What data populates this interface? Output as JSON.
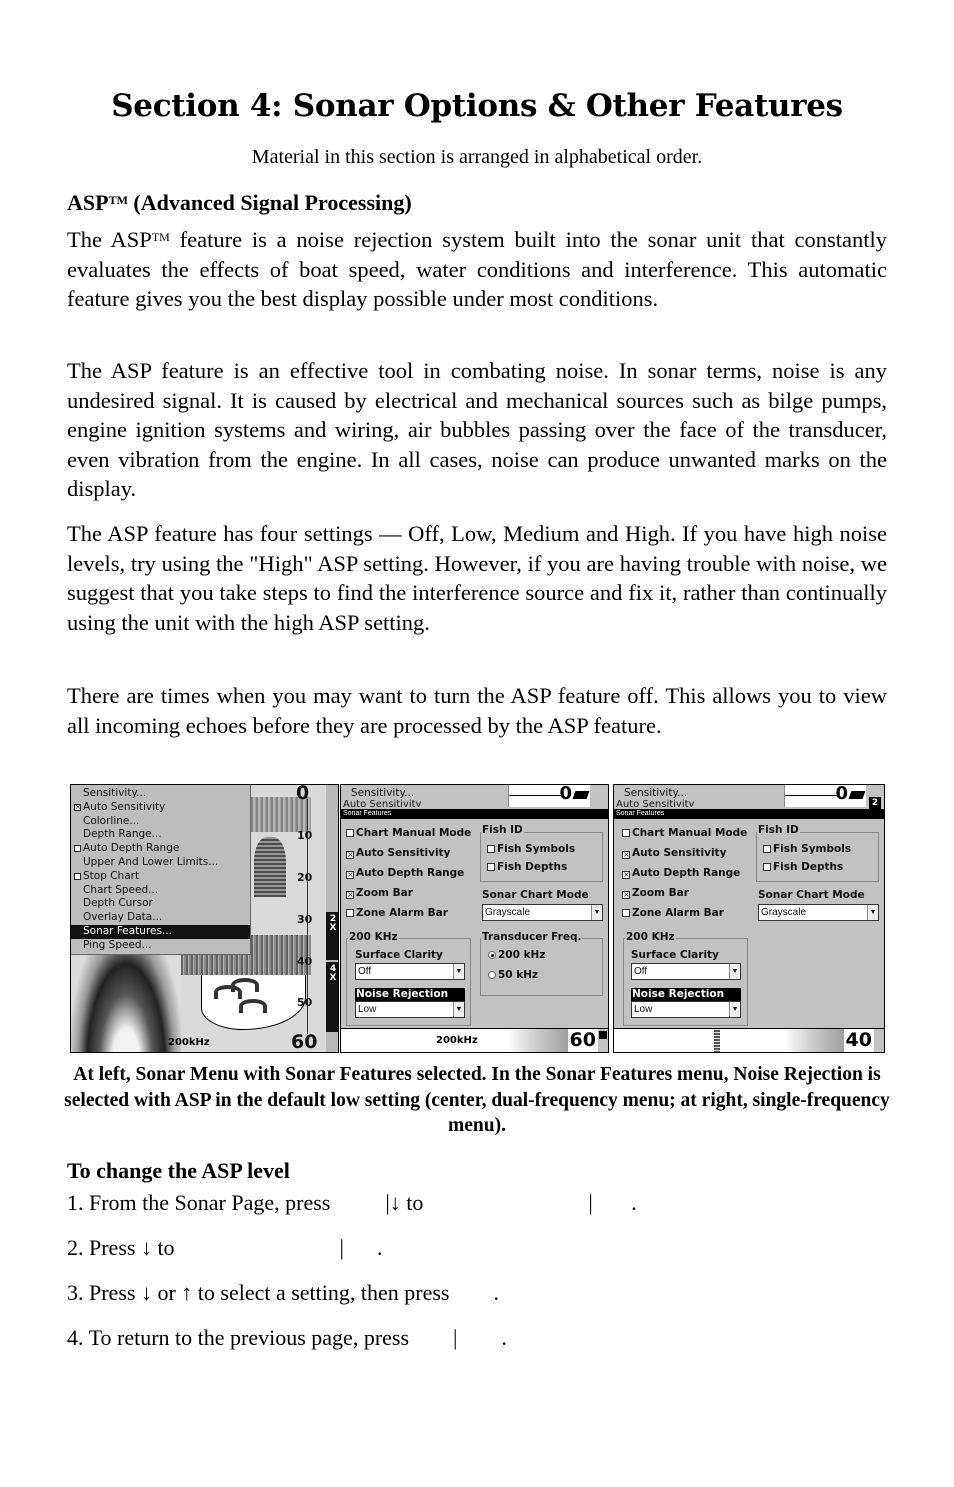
{
  "page": {
    "title": "Section 4: Sonar Options & Other Features",
    "subtitle": "Material in this section is arranged in alphabetical order."
  },
  "asp_section": {
    "heading_prefix": "ASP",
    "heading_tm": "TM",
    "heading_suffix": " (Advanced Signal Processing)",
    "paragraphs": [
      {
        "prefix": "The ASP",
        "tm": "TM",
        "text": " feature is a noise rejection system built into the sonar unit that constantly evaluates the effects of boat speed, water conditions and interference. This automatic feature gives you the best display possible under most conditions."
      },
      {
        "text": "The ASP feature is an effective tool in combating noise. In sonar terms, noise is any undesired signal. It is caused by electrical and mechanical sources such as bilge pumps, engine ignition systems and wiring, air bubbles passing over the face of the transducer, even vibration from the engine. In all cases, noise can produce unwanted marks on the display."
      },
      {
        "text": "The ASP feature has four settings — Off, Low, Medium and High. If you have high noise levels, try using the \"High\" ASP setting. However, if you are having trouble with noise, we suggest that you take steps to find the interference source and fix it, rather than continually using the unit with the high ASP setting."
      },
      {
        "text": "There are times when you may want to turn the ASP feature off. This allows you to view all incoming echoes before they are processed by the ASP feature."
      }
    ]
  },
  "screenshots": {
    "left": {
      "menu_items": [
        {
          "label": "Sensitivity...",
          "checkbox": null,
          "selected": false
        },
        {
          "label": "Auto Sensitivity",
          "checkbox": true,
          "selected": false
        },
        {
          "label": "Colorline...",
          "checkbox": null,
          "selected": false
        },
        {
          "label": "Depth Range...",
          "checkbox": null,
          "selected": false
        },
        {
          "label": "Auto Depth Range",
          "checkbox": false,
          "selected": false
        },
        {
          "label": "Upper And Lower Limits...",
          "checkbox": null,
          "selected": false
        },
        {
          "label": "Stop Chart",
          "checkbox": false,
          "selected": false
        },
        {
          "label": "Chart Speed...",
          "checkbox": null,
          "selected": false
        },
        {
          "label": "Depth Cursor",
          "checkbox": null,
          "selected": false
        },
        {
          "label": "Overlay Data...",
          "checkbox": null,
          "selected": false
        },
        {
          "label": "Sonar Features...",
          "checkbox": null,
          "selected": true
        },
        {
          "label": "Ping Speed...",
          "checkbox": null,
          "selected": false
        }
      ],
      "depth_scale": [
        "0",
        "10",
        "20",
        "30",
        "40",
        "50",
        "60"
      ],
      "zoom_labels": [
        "2 X",
        "4 X"
      ],
      "frequency": "200kHz",
      "bottom_depth": "60"
    },
    "middle": {
      "menu_peek": "Sensitivity...",
      "menu_peek2": "Auto Sensitivity",
      "top_depth": "0",
      "dialog_title": "Sonar Features",
      "checkboxes": [
        {
          "label": "Chart Manual Mode",
          "checked": false
        },
        {
          "label": "Auto Sensitivity",
          "checked": true
        },
        {
          "label": "Auto Depth Range",
          "checked": true
        },
        {
          "label": "Zoom Bar",
          "checked": true
        },
        {
          "label": "Zone Alarm Bar",
          "checked": false
        }
      ],
      "fish_id": {
        "label": "Fish ID",
        "options": [
          {
            "label": "Fish Symbols",
            "checked": false
          },
          {
            "label": "Fish Depths",
            "checked": false
          }
        ]
      },
      "sonar_chart_mode": {
        "label": "Sonar Chart Mode",
        "value": "Grayscale"
      },
      "freq_group": {
        "label": "200 KHz",
        "surface_clarity": {
          "label": "Surface Clarity",
          "value": "Off"
        },
        "noise_rejection": {
          "label": "Noise Rejection",
          "value": "Low"
        }
      },
      "transducer_freq": {
        "label": "Transducer Freq.",
        "options": [
          {
            "label": "200 kHz",
            "selected": true
          },
          {
            "label": "50 kHz",
            "selected": false
          }
        ]
      },
      "status_frequency": "200kHz",
      "status_depth": "60"
    },
    "right": {
      "menu_peek": "Sensitivity...",
      "menu_peek2": "Auto Sensitivity",
      "top_depth": "0",
      "zoom_badge": "2",
      "dialog_title": "Sonar Features",
      "checkboxes": [
        {
          "label": "Chart Manual Mode",
          "checked": false
        },
        {
          "label": "Auto Sensitivity",
          "checked": true
        },
        {
          "label": "Auto Depth Range",
          "checked": true
        },
        {
          "label": "Zoom Bar",
          "checked": true
        },
        {
          "label": "Zone Alarm Bar",
          "checked": false
        }
      ],
      "fish_id": {
        "label": "Fish ID",
        "options": [
          {
            "label": "Fish Symbols",
            "checked": false
          },
          {
            "label": "Fish Depths",
            "checked": false
          }
        ]
      },
      "sonar_chart_mode": {
        "label": "Sonar Chart Mode",
        "value": "Grayscale"
      },
      "freq_group": {
        "label": "200 KHz",
        "surface_clarity": {
          "label": "Surface Clarity",
          "value": "Off"
        },
        "noise_rejection": {
          "label": "Noise Rejection",
          "value": "Low"
        }
      },
      "status_depth": "40"
    }
  },
  "caption": "At left, Sonar Menu with Sonar Features selected. In the Sonar Features menu, Noise Rejection is selected with ASP in the default low setting (center, dual-frequency menu; at right, single-frequency menu).",
  "procedure": {
    "heading": "To change the ASP level",
    "steps": [
      "1. From the Sonar Page, press          |↓ to                              |       .",
      "2. Press ↓ to                              |      .",
      "3. Press ↓ or ↑ to select a setting, then press        .",
      "4. To return to the previous page, press        |        ."
    ]
  }
}
